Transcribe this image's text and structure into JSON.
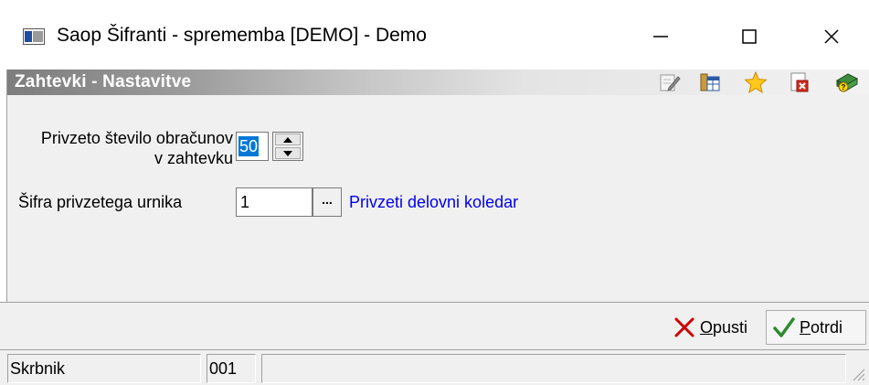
{
  "window": {
    "title": "Saop Šifranti - sprememba [DEMO] - Demo",
    "minimize": "—",
    "maximize": "☐",
    "close": "✕"
  },
  "header": {
    "title": "Zahtevki - Nastavitve",
    "tools": [
      "edit-icon",
      "grid-icon",
      "favorite-star-icon",
      "close-document-icon",
      "help-book-icon"
    ]
  },
  "form": {
    "count_label": "Privzeto število obračunov v zahtevku",
    "count_value": "50",
    "code_label": "Šifra privzetega urnika",
    "code_value": "1",
    "browse_label": "...",
    "calendar_link": "Privzeti delovni koledar"
  },
  "buttons": {
    "cancel_accel": "O",
    "cancel_rest": "pusti",
    "ok_accel": "P",
    "ok_rest": "otrdi"
  },
  "status": {
    "user": "Skrbnik",
    "code": "001",
    "message": ""
  },
  "colors": {
    "selection": "#0078d7",
    "link": "#0000ee",
    "cancel_x": "#cc0000",
    "ok_check": "#2e8b2e"
  }
}
